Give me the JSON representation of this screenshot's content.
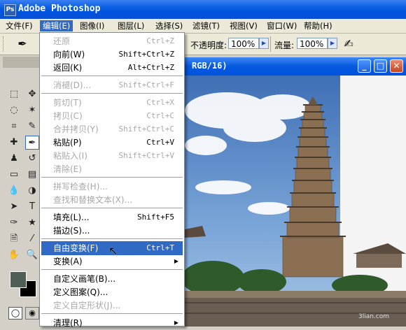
{
  "app": {
    "title": "Adobe Photoshop",
    "icon_text": "Ps"
  },
  "menubar": [
    {
      "label": "文件(F)"
    },
    {
      "label": "编辑(E)",
      "active": true
    },
    {
      "label": "图像(I)"
    },
    {
      "label": "图层(L)"
    },
    {
      "label": "选择(S)"
    },
    {
      "label": "滤镜(T)"
    },
    {
      "label": "视图(V)"
    },
    {
      "label": "窗口(W)"
    },
    {
      "label": "帮助(H)"
    }
  ],
  "options": {
    "opacity_label": "不透明度:",
    "opacity_value": "100%",
    "flow_label": "流量:",
    "flow_value": "100%"
  },
  "document": {
    "title": "RGB/16)",
    "min": "_",
    "max": "□",
    "close": "✕"
  },
  "edit_menu": {
    "items": [
      {
        "label": "还原",
        "shortcut": "Ctrl+Z",
        "disabled": true
      },
      {
        "label": "向前(W)",
        "shortcut": "Shift+Ctrl+Z"
      },
      {
        "label": "返回(K)",
        "shortcut": "Alt+Ctrl+Z"
      },
      {
        "sep": true
      },
      {
        "label": "消褪(D)...",
        "shortcut": "Shift+Ctrl+F",
        "disabled": true
      },
      {
        "sep": true
      },
      {
        "label": "剪切(T)",
        "shortcut": "Ctrl+X",
        "disabled": true
      },
      {
        "label": "拷贝(C)",
        "shortcut": "Ctrl+C",
        "disabled": true
      },
      {
        "label": "合并拷贝(Y)",
        "shortcut": "Shift+Ctrl+C",
        "disabled": true
      },
      {
        "label": "粘贴(P)",
        "shortcut": "Ctrl+V"
      },
      {
        "label": "粘贴入(I)",
        "shortcut": "Shift+Ctrl+V",
        "disabled": true
      },
      {
        "label": "清除(E)",
        "disabled": true
      },
      {
        "sep": true
      },
      {
        "label": "拼写检查(H)...",
        "disabled": true
      },
      {
        "label": "查找和替换文本(X)...",
        "disabled": true
      },
      {
        "sep": true
      },
      {
        "label": "填充(L)...",
        "shortcut": "Shift+F5"
      },
      {
        "label": "描边(S)..."
      },
      {
        "sep": true
      },
      {
        "label": "自由变换(F)",
        "shortcut": "Ctrl+T",
        "highlighted": true
      },
      {
        "label": "变换(A)",
        "submenu": true
      },
      {
        "sep": true
      },
      {
        "label": "自定义画笔(B)..."
      },
      {
        "label": "定义图案(Q)..."
      },
      {
        "label": "定义自定形状(J)...",
        "disabled": true
      },
      {
        "sep": true
      },
      {
        "label": "清理(R)",
        "submenu": true
      }
    ]
  },
  "toolbox": {
    "tools": [
      {
        "name": "marquee-tool",
        "glyph": "⬚"
      },
      {
        "name": "move-tool",
        "glyph": "✥"
      },
      {
        "name": "lasso-tool",
        "glyph": "◌"
      },
      {
        "name": "magic-wand-tool",
        "glyph": "✶"
      },
      {
        "name": "crop-tool",
        "glyph": "⌗"
      },
      {
        "name": "slice-tool",
        "glyph": "✎"
      },
      {
        "name": "healing-brush-tool",
        "glyph": "✚"
      },
      {
        "name": "brush-tool",
        "glyph": "✒",
        "selected": true
      },
      {
        "name": "clone-stamp-tool",
        "glyph": "♟"
      },
      {
        "name": "history-brush-tool",
        "glyph": "↺"
      },
      {
        "name": "eraser-tool",
        "glyph": "▭"
      },
      {
        "name": "gradient-tool",
        "glyph": "▤"
      },
      {
        "name": "blur-tool",
        "glyph": "💧"
      },
      {
        "name": "dodge-tool",
        "glyph": "◑"
      },
      {
        "name": "path-select-tool",
        "glyph": "➤"
      },
      {
        "name": "type-tool",
        "glyph": "T"
      },
      {
        "name": "pen-tool",
        "glyph": "✑"
      },
      {
        "name": "shape-tool",
        "glyph": "★"
      },
      {
        "name": "notes-tool",
        "glyph": "🗎"
      },
      {
        "name": "eyedropper-tool",
        "glyph": "⁄"
      },
      {
        "name": "hand-tool",
        "glyph": "✋"
      },
      {
        "name": "zoom-tool",
        "glyph": "🔍"
      }
    ],
    "foreground_color": "#4f5f55",
    "background_color": "#000000"
  },
  "watermark": "3lian.com"
}
